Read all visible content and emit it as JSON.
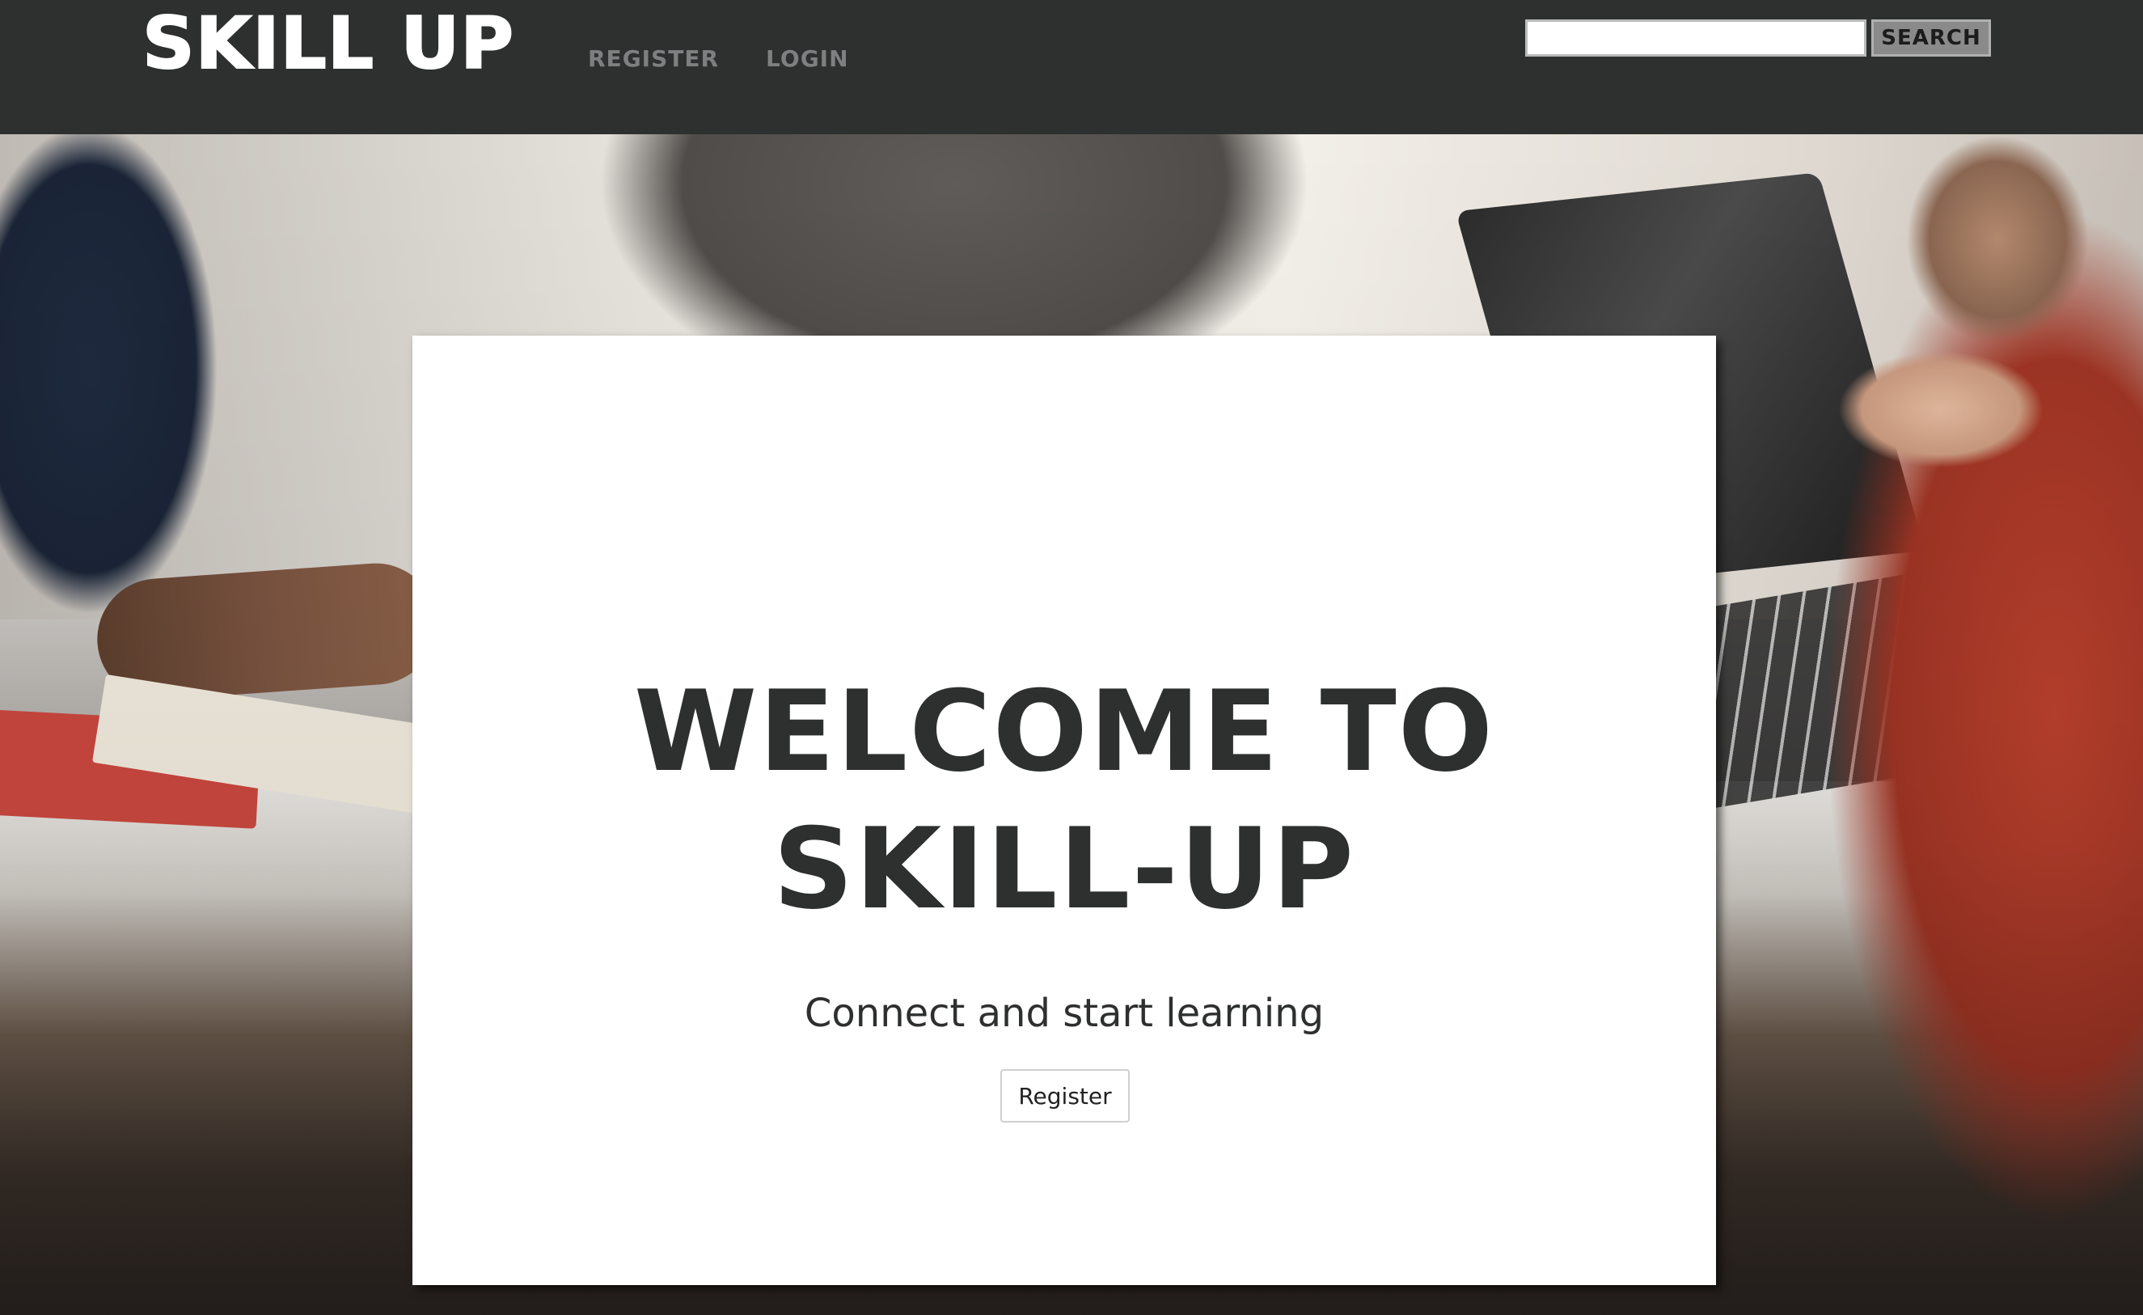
{
  "header": {
    "logo": "SKILL UP",
    "nav": [
      {
        "label": "REGISTER"
      },
      {
        "label": "LOGIN"
      }
    ],
    "search": {
      "value": "",
      "placeholder": "",
      "button_label": "SEARCH"
    }
  },
  "hero": {
    "title": "WELCOME TO SKILL-UP",
    "subtitle": "Connect and start learning",
    "button_label": "Register"
  },
  "colors": {
    "header_bg": "#2e3030",
    "nav_text": "#7d7f80",
    "card_bg": "#ffffff",
    "title_text": "#2e3030"
  }
}
